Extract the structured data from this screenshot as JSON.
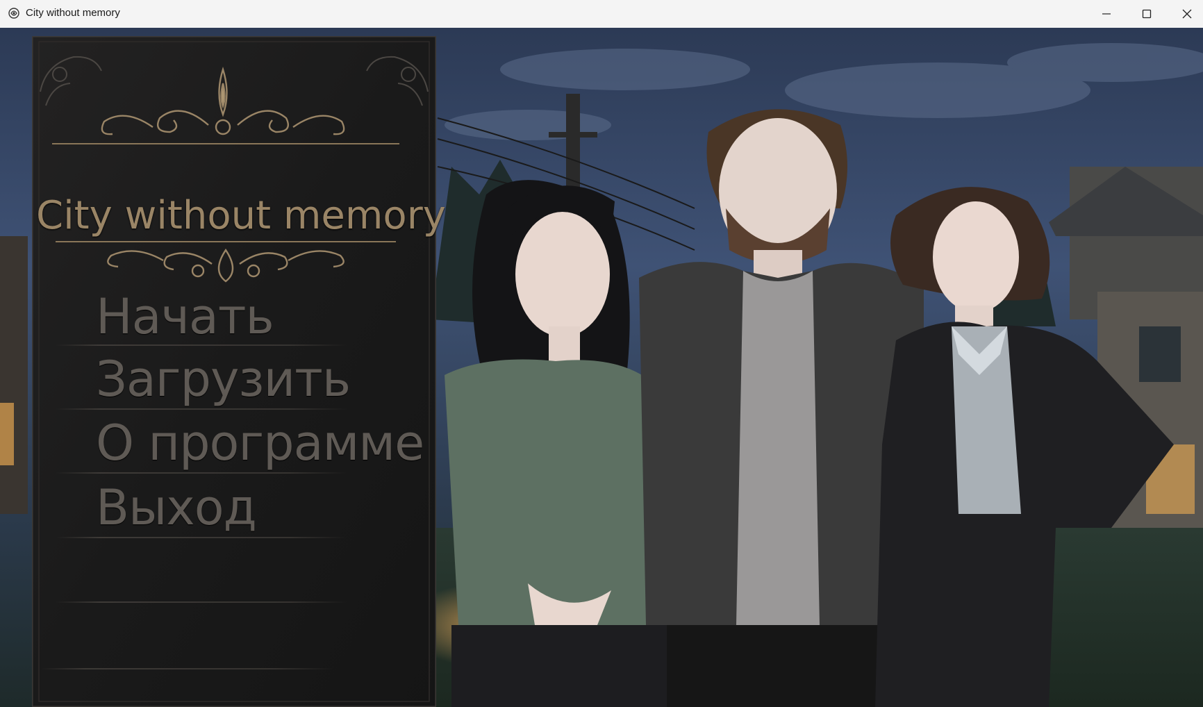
{
  "window": {
    "title": "City without memory",
    "controls": [
      "minimize-icon",
      "maximize-icon",
      "close-icon"
    ]
  },
  "menu": {
    "title": "City without memory",
    "items": [
      {
        "label": "Начать"
      },
      {
        "label": "Загрузить"
      },
      {
        "label": "О программе"
      },
      {
        "label": "Выход"
      }
    ]
  },
  "colors": {
    "title_gold": "#9a8566",
    "menu_text": "#5f5a55",
    "panel_bg": "#1c1c1c",
    "sky": "#3e4f6e"
  }
}
